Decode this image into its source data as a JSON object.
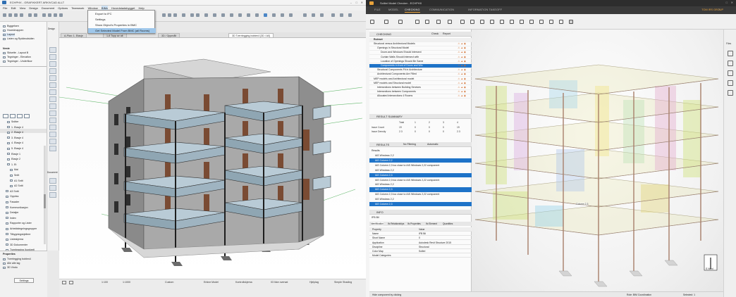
{
  "left_app": {
    "title": "ECHPHX - GRAFIKKERT ARKIVCAD ALLT",
    "menu": [
      "File",
      "Edit",
      "View",
      "Design",
      "Document",
      "Options",
      "Teamwork",
      "Window",
      "BIMx",
      "Hovedstadsbygget",
      "Help"
    ],
    "ifc_menu_label": "IFC",
    "dropdown": [
      "Export to IFC",
      "Settings",
      "Show Object's Properties in BMC",
      "Get Selected Model From BMC (all Rooms)"
    ],
    "tabs": [
      "A-Plan: 1. Etasje",
      "1-8 Topp av alt",
      "3D / Oppmålt",
      "3D Tverrlegging boblen4 [3D / All]"
    ],
    "navigator_top": [
      "Byggelsen",
      "Hovedmappen",
      "Layout",
      "Listen og Ryddeudsiden"
    ],
    "navigator_mid_header": "Neste",
    "navigator_mid": [
      "Skisette - Layout B",
      "Tegninger - Elevation",
      "Tegninger - Underfloor"
    ],
    "navigator_tree": [
      "Snitter",
      "1. Etasje 4",
      "2. Etasje 4",
      "3. Etasje 4",
      "4. Etasje 4",
      "5. Etasje 4",
      "Etasje 1",
      "Etasje 2",
      "1. Et",
      "Mai",
      "Snitt",
      "A1 Snitt",
      "A2 Snitt",
      "A3 Snitt",
      "Oppriss",
      "Fasader",
      "Kommunikasjon",
      "Detaljer",
      "Index",
      "Rapporter og Lister",
      "Arbeidstegningsgrupper",
      "Tilbygningskjellere",
      "Listeskjema",
      "3D Dokumenter",
      "Tverrlegging (konkret)",
      "Tverrlegging (konkret fra)"
    ],
    "navigator_selected": "3D Tverrlegging boblen4",
    "properties_header": "Properties",
    "properties_rows": [
      "Tverrlegging boblen4",
      "Alle alle lag",
      "3D Vindu",
      "Settings"
    ],
    "status_items": [
      "1:100",
      "1:1000",
      "Custom",
      "Erkine Model",
      "Kontrollskjema",
      "03 Ikke oversat",
      "Hjelplag",
      "Simple Shading"
    ],
    "toolbox_label": "Design",
    "toolbox_label2": "Document"
  },
  "right_app": {
    "title": "Solibri Model Checker - ECHPHX",
    "nav": [
      "FILE",
      "MODEL",
      "CHECKING",
      "COMMUNICATION",
      "INFORMATION TAKEOFF",
      "?"
    ],
    "nav_active": "CHECKING",
    "user": "TOM IRS GROUP",
    "checking_header": "CHECKING",
    "checking_toolbar": [
      "Check",
      "Report"
    ],
    "checking_rule_header": "Ruleset",
    "checking_rows": [
      {
        "label": "Structural versus Architectural Models",
        "indent": 0,
        "selected": false
      },
      {
        "label": "Openings in Structural Model",
        "indent": 1,
        "selected": false
      },
      {
        "label": "Doors and Windows Should Intersect",
        "indent": 2,
        "selected": false
      },
      {
        "label": "Curtain Walls Should Intersect with",
        "indent": 2,
        "selected": false
      },
      {
        "label": "Location of Openings Should Be Same",
        "indent": 2,
        "selected": false
      },
      {
        "label": "Components in front of Doors and Win",
        "indent": 2,
        "selected": true
      },
      {
        "label": "Structural Components Fit in Architecture",
        "indent": 1,
        "selected": false
      },
      {
        "label": "Architectural Components Are Filled",
        "indent": 1,
        "selected": false
      },
      {
        "label": "MEP models and Architectural model",
        "indent": 0,
        "selected": false
      },
      {
        "label": "MEP models and Structural model",
        "indent": 0,
        "selected": false
      },
      {
        "label": "Intersections between Building Services",
        "indent": 1,
        "selected": false
      },
      {
        "label": "Intersections between Components",
        "indent": 1,
        "selected": false
      },
      {
        "label": "Allocated Intersections 4 Rooms",
        "indent": 1,
        "selected": false
      }
    ],
    "result_summary_header": "RESULT SUMMARY",
    "summary_cols": [
      "",
      "Total",
      "1",
      "2",
      "3",
      "4"
    ],
    "summary_rows": [
      [
        "Issue Count",
        "19",
        "0",
        "0",
        "0",
        "19"
      ],
      [
        "Issue Density",
        "2.3",
        "0",
        "0",
        "0",
        "2.3"
      ]
    ],
    "results_header": "RESULTS",
    "results_filter": "No Filtering",
    "results_mode": "Automatic",
    "results_label": "Results",
    "results_rows": [
      {
        "label": "IAS Windows 2,2",
        "selected": false
      },
      {
        "label": "IAS Column 2,2",
        "selected": true
      },
      {
        "label": "IAS Column 2,3 too close to IAS Windows 2,22 component",
        "selected": false
      },
      {
        "label": "IAS Windows 2,2",
        "selected": false
      },
      {
        "label": "IAS Column 2,3",
        "selected": true
      },
      {
        "label": "IAS Column 2,3 too close to IAS Windows 2,22 component",
        "selected": false
      },
      {
        "label": "IAS Windows 2,2",
        "selected": false
      },
      {
        "label": "IAS Column 2,3",
        "selected": true
      },
      {
        "label": "IAS Column 2,3 too close to IAS Windows 2,22 component",
        "selected": false
      },
      {
        "label": "IAS Windows 2,2",
        "selected": false
      },
      {
        "label": "IAS Column 2,3",
        "selected": true
      }
    ],
    "info_header": "INFO",
    "info_object": "IFB Bil",
    "info_tabs": [
      "Identification",
      "Ifc Relationships",
      "Ifc Properties",
      "Ifc Element",
      "Quantities"
    ],
    "info_rows": [
      [
        "Property",
        "Value"
      ],
      [
        "Name",
        "IFB Bil"
      ],
      [
        "Short Name",
        "0"
      ],
      [
        "Application",
        "Autodesk Revit Structure 2015"
      ],
      [
        "Discipline",
        "Structural"
      ],
      [
        "Color Map",
        "Solibri"
      ],
      [
        "Model Categories",
        ""
      ]
    ],
    "status_left": "Hide component by clicking",
    "status_mid": "Role: BIM Coordination",
    "status_right": "Selected: 1",
    "view_label": "Column 2,3",
    "compass_label": "S Nord"
  },
  "colors": {
    "selection_blue": "#1e73c8",
    "accent_orange": "#e8a23a",
    "facade_gray": "#8c8c8c",
    "balcony_glass": "#b9cbd6",
    "door_brown": "#7a4b33",
    "column_brown": "#9a6a52"
  }
}
